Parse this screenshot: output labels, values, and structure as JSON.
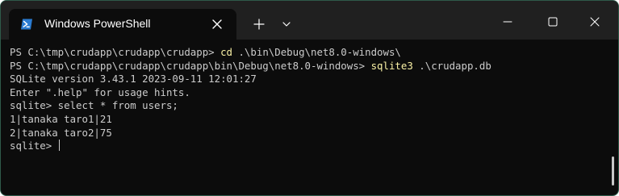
{
  "window": {
    "tab_title": "Windows PowerShell"
  },
  "terminal": {
    "lines": [
      {
        "prefix": "PS C:\\tmp\\crudapp\\crudapp\\crudapp> ",
        "command": "cd",
        "args": " .\\bin\\Debug\\net8.0-windows\\"
      },
      {
        "prefix": "PS C:\\tmp\\crudapp\\crudapp\\crudapp\\bin\\Debug\\net8.0-windows> ",
        "command": "sqlite3",
        "args": " .\\crudapp.db"
      },
      {
        "text": "SQLite version 3.43.1 2023-09-11 12:01:27"
      },
      {
        "text": "Enter \".help\" for usage hints."
      },
      {
        "text": "sqlite> select * from users;"
      },
      {
        "text": "1|tanaka taro1|21"
      },
      {
        "text": "2|tanaka taro2|75"
      },
      {
        "text": "sqlite> "
      }
    ]
  },
  "icons": {
    "tab": "powershell-icon",
    "tab_close": "close-icon",
    "new_tab": "plus-icon",
    "dropdown": "chevron-down-icon",
    "minimize": "minimize-icon",
    "maximize": "maximize-icon",
    "close": "close-icon"
  },
  "colors": {
    "command": "#f9f1a5",
    "text": "#cccccc",
    "background": "#0c0c0c",
    "titlebar": "#202020"
  }
}
